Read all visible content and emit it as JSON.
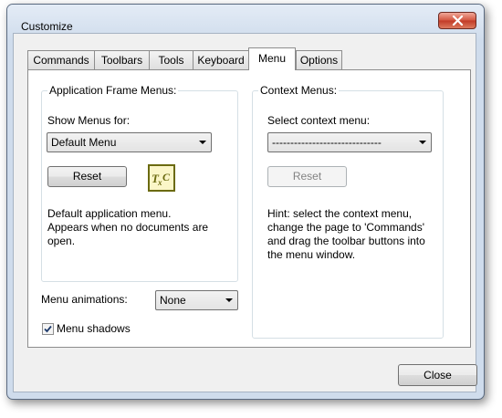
{
  "window": {
    "title": "Customize"
  },
  "tabs": [
    {
      "label": "Commands"
    },
    {
      "label": "Toolbars"
    },
    {
      "label": "Tools"
    },
    {
      "label": "Keyboard"
    },
    {
      "label": "Menu",
      "active": true
    },
    {
      "label": "Options"
    }
  ],
  "app_frame_menus": {
    "group_label": "Application Frame Menus:",
    "show_menus_label": "Show Menus for:",
    "show_menus_value": "Default Menu",
    "reset_label": "Reset",
    "description_line1": "Default application menu.",
    "description_line2": "Appears when no documents are",
    "description_line3": "open.",
    "app_icon": "txc-icon"
  },
  "context_menus": {
    "group_label": "Context Menus:",
    "select_label": "Select context menu:",
    "select_value": "------------------------------",
    "reset_label": "Reset",
    "hint_line1": "Hint: select the context menu,",
    "hint_line2": "change the page to 'Commands'",
    "hint_line3": "and drag the toolbar buttons into",
    "hint_line4": "the menu window."
  },
  "menu_animations": {
    "label": "Menu animations:",
    "value": "None"
  },
  "menu_shadows": {
    "label": "Menu shadows",
    "checked": true
  },
  "footer": {
    "close_label": "Close"
  },
  "colors": {
    "icon_border": "#6b6a10",
    "close_button": "#c13a26"
  }
}
